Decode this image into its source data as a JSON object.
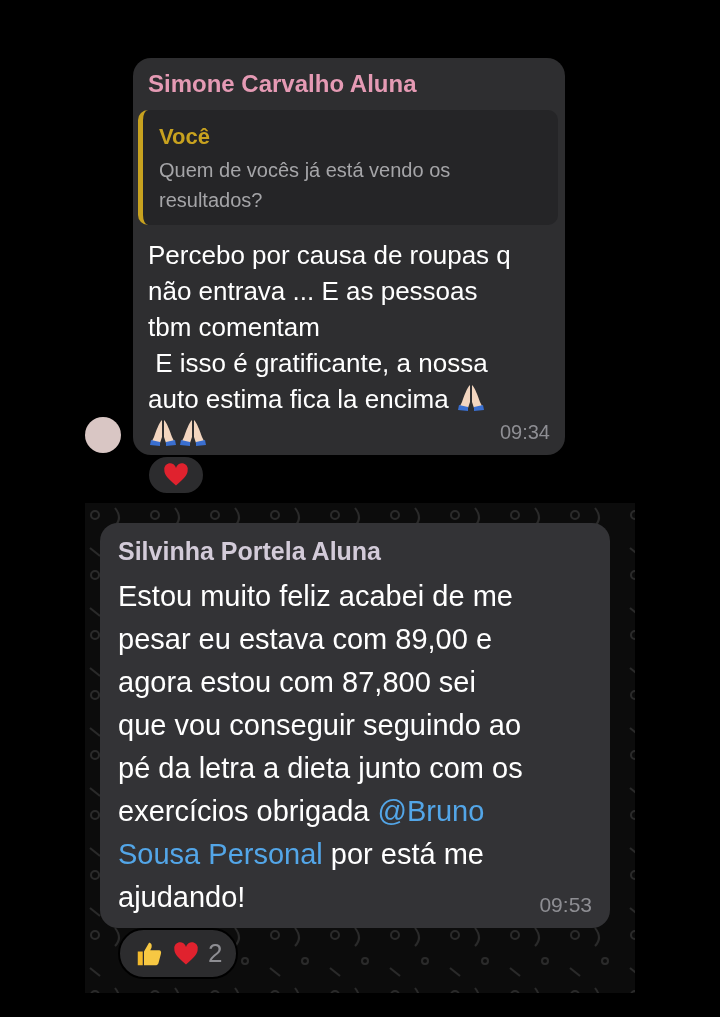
{
  "messages": [
    {
      "sender": "Simone Carvalho Aluna",
      "reply": {
        "author": "Você",
        "text": "Quem de vocês já está vendo os\nresultados?"
      },
      "body": [
        {
          "kind": "line",
          "text": "Percebo por causa de roupas q\nnão entrava ... E as pessoas\ntbm comentam\n E isso é gratificante, a nossa"
        },
        {
          "kind": "line",
          "text": "auto estima fica la encima"
        }
      ],
      "time": "09:34",
      "reactions": [
        {
          "kind": "heart"
        }
      ]
    },
    {
      "sender": "Silvinha Portela Aluna",
      "body": [
        {
          "kind": "text",
          "text": "Estou muito feliz acabei de me\npesar eu estava com 89,00 e\nagora estou com 87,800 sei\nque vou conseguir seguindo ao\npé da letra a dieta junto com os\nexercícios obrigada "
        },
        {
          "kind": "mention",
          "text": "@Bruno"
        },
        {
          "kind": "break"
        },
        {
          "kind": "mention",
          "text": "Sousa Personal"
        },
        {
          "kind": "text",
          "text": " por está me\najudando!"
        }
      ],
      "time": "09:53",
      "reactions": [
        {
          "kind": "thumbs-up"
        },
        {
          "kind": "heart"
        }
      ],
      "reaction_count": "2"
    }
  ]
}
